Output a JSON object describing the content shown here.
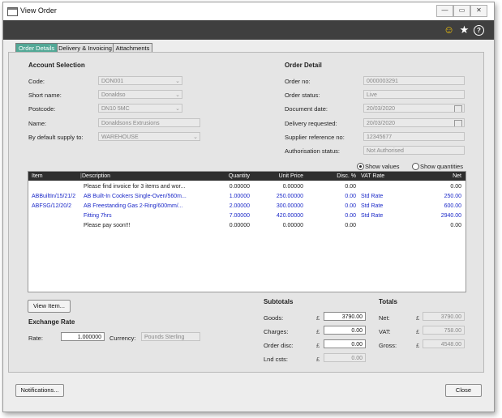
{
  "window": {
    "title": "View Order",
    "min_label": "—",
    "max_label": "▭",
    "close_label": "✕"
  },
  "toolbar": {
    "smiley_icon": "☺",
    "star_icon": "★",
    "help_icon": "?"
  },
  "tabs": [
    {
      "label": "Order Details",
      "active": true
    },
    {
      "label": "Delivery & Invoicing",
      "active": false
    },
    {
      "label": "Attachments",
      "active": false
    }
  ],
  "account": {
    "heading": "Account Selection",
    "code_label": "Code:",
    "code_value": "DON001",
    "short_name_label": "Short name:",
    "short_name_value": "Donaldso",
    "postcode_label": "Postcode:",
    "postcode_value": "DN10 5MC",
    "name_label": "Name:",
    "name_value": "Donaldsons Extrusions",
    "supply_label": "By default supply to:",
    "supply_value": "WAREHOUSE"
  },
  "order": {
    "heading": "Order Detail",
    "order_no_label": "Order no:",
    "order_no_value": "0000003291",
    "status_label": "Order status:",
    "status_value": "Live",
    "doc_date_label": "Document date:",
    "doc_date_value": "20/03/2020",
    "delivery_label": "Delivery requested:",
    "delivery_value": "20/03/2020",
    "supplier_ref_label": "Supplier reference no:",
    "supplier_ref_value": "12345677",
    "auth_label": "Authorisation status:",
    "auth_value": "Not Authorised"
  },
  "view_options": {
    "show_values": "Show values",
    "show_quantities": "Show quantities"
  },
  "grid": {
    "columns": [
      "Item",
      "Description",
      "Quantity",
      "Unit Price",
      "Disc. %",
      "VAT Rate",
      "Net"
    ],
    "rows": [
      {
        "item": "",
        "desc": "Please find invoice for 3 items and wor...",
        "qty": "0.00000",
        "price": "0.00000",
        "disc": "0.00",
        "vat": "",
        "net": "0.00",
        "blue": false
      },
      {
        "item": "ABBuiltIn/15/21/2",
        "desc": "AB Built-In Cookers Single-Oven/560m...",
        "qty": "1.00000",
        "price": "250.00000",
        "disc": "0.00",
        "vat": "Std Rate",
        "net": "250.00",
        "blue": true
      },
      {
        "item": "ABFSG/12/20/2",
        "desc": "AB Freestanding Gas 2-Ring/600mm/...",
        "qty": "2.00000",
        "price": "300.00000",
        "disc": "0.00",
        "vat": "Std Rate",
        "net": "600.00",
        "blue": true
      },
      {
        "item": "",
        "desc": "Fitting 7hrs",
        "qty": "7.00000",
        "price": "420.00000",
        "disc": "0.00",
        "vat": "Std Rate",
        "net": "2940.00",
        "blue": true
      },
      {
        "item": "",
        "desc": "Please pay soon!!!",
        "qty": "0.00000",
        "price": "0.00000",
        "disc": "0.00",
        "vat": "",
        "net": "0.00",
        "blue": false
      }
    ]
  },
  "view_item_label": "View Item...",
  "exchange": {
    "heading": "Exchange Rate",
    "rate_label": "Rate:",
    "rate_value": "1.000000",
    "currency_label": "Currency:",
    "currency_value": "Pounds Sterling"
  },
  "subtotals": {
    "heading": "Subtotals",
    "currency_symbol": "£",
    "goods_label": "Goods:",
    "goods_value": "3790.00",
    "charges_label": "Charges:",
    "charges_value": "0.00",
    "order_disc_label": "Order disc:",
    "order_disc_value": "0.00",
    "lnd_csts_label": "Lnd csts:",
    "lnd_csts_value": "0.00"
  },
  "totals": {
    "heading": "Totals",
    "net_label": "Net:",
    "net_value": "3790.00",
    "vat_label": "VAT:",
    "vat_value": "758.00",
    "gross_label": "Gross:",
    "gross_value": "4548.00"
  },
  "footer": {
    "notifications_label": "Notifications...",
    "close_label": "Close"
  }
}
